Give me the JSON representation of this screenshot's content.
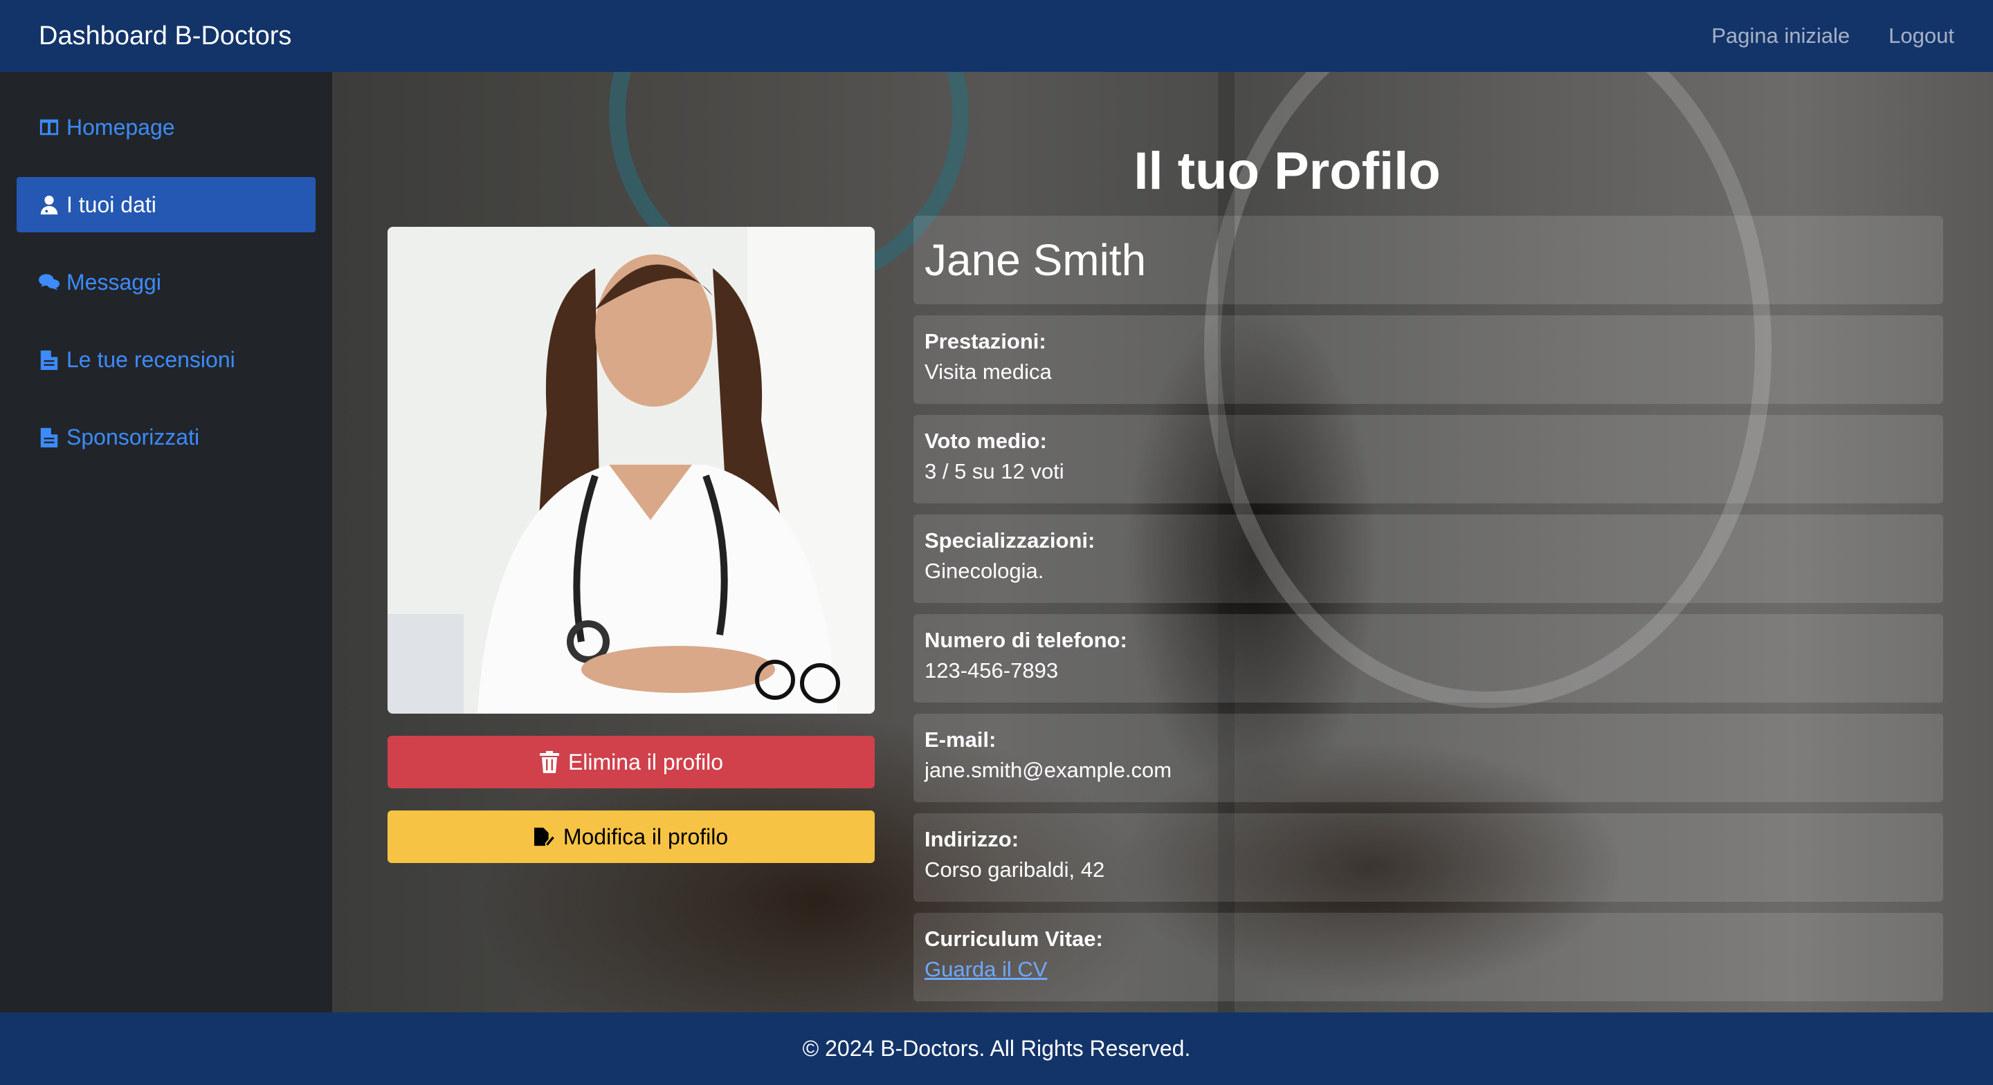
{
  "app": {
    "brand": "Dashboard B-Doctors"
  },
  "topnav": {
    "home": "Pagina iniziale",
    "logout": "Logout"
  },
  "sidebar": {
    "items": [
      {
        "label": "Homepage",
        "icon": "columns-icon"
      },
      {
        "label": "I tuoi dati",
        "icon": "user-doctor-icon",
        "active": true
      },
      {
        "label": "Messaggi",
        "icon": "comments-icon"
      },
      {
        "label": "Le tue recensioni",
        "icon": "file-icon"
      },
      {
        "label": "Sponsorizzati",
        "icon": "file-icon"
      }
    ]
  },
  "profile": {
    "page_title": "Il tuo Profilo",
    "name": "Jane Smith",
    "delete_label": "Elimina il profilo",
    "edit_label": "Modifica il profilo",
    "fields": [
      {
        "label": "Prestazioni:",
        "value": "Visita medica"
      },
      {
        "label": "Voto medio:",
        "value": "3 / 5 su 12 voti"
      },
      {
        "label": "Specializzazioni:",
        "value": "Ginecologia."
      },
      {
        "label": "Numero di telefono:",
        "value": "123-456-7893"
      },
      {
        "label": "E-mail:",
        "value": "jane.smith@example.com"
      },
      {
        "label": "Indirizzo:",
        "value": "Corso garibaldi, 42"
      },
      {
        "label": "Curriculum Vitae:",
        "value": "Guarda il CV"
      }
    ]
  },
  "footer": {
    "text": "© 2024 B-Doctors. All Rights Reserved."
  },
  "colors": {
    "navbar": "#133469",
    "sidebar": "#212529",
    "active_item": "#2458b3",
    "link": "#3d8bfd",
    "delete_button": "#d0414b",
    "edit_button": "#f6c345"
  }
}
